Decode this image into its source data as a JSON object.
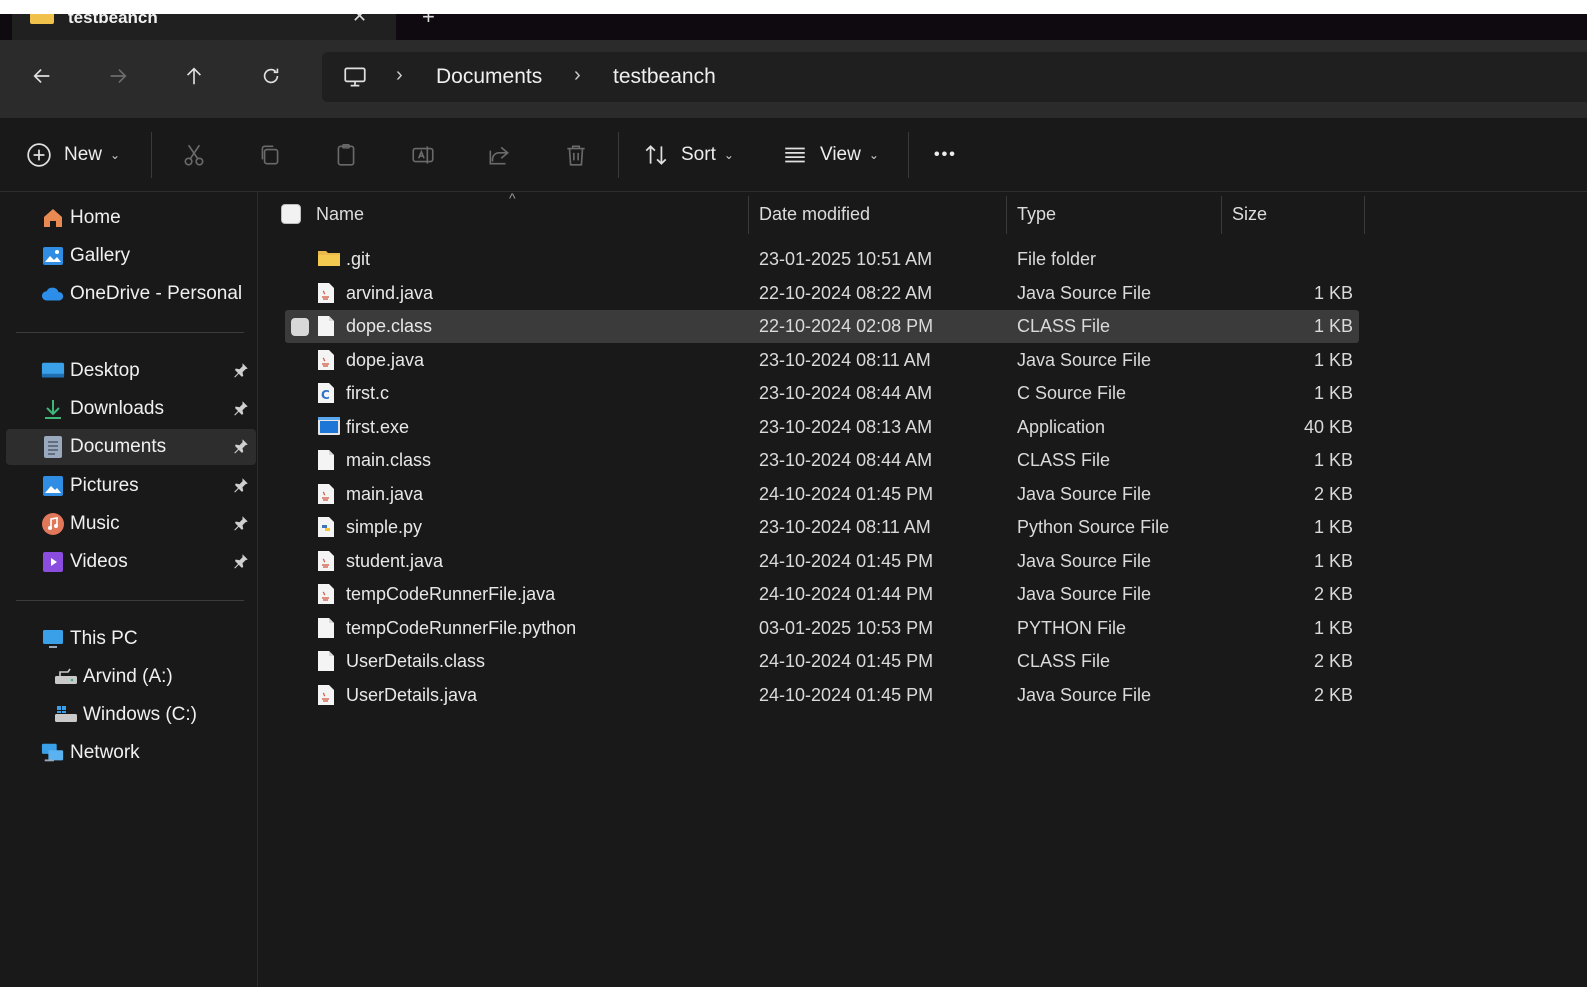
{
  "tab": {
    "title": "testbeanch",
    "close": "✕",
    "new": "+"
  },
  "address": {
    "crumbs": [
      "Documents",
      "testbeanch"
    ],
    "separator": "›"
  },
  "toolbar": {
    "new_label": "New",
    "sort_label": "Sort",
    "view_label": "View",
    "more_label": "•••",
    "chevron": "⌄"
  },
  "sidebar": {
    "quick": [
      {
        "label": "Home",
        "icon": "home-icon"
      },
      {
        "label": "Gallery",
        "icon": "gallery-icon"
      },
      {
        "label": "OneDrive - Personal",
        "icon": "onedrive-icon"
      }
    ],
    "pinned": [
      {
        "label": "Desktop",
        "icon": "desktop-icon"
      },
      {
        "label": "Downloads",
        "icon": "downloads-icon"
      },
      {
        "label": "Documents",
        "icon": "documents-icon",
        "active": true
      },
      {
        "label": "Pictures",
        "icon": "pictures-icon"
      },
      {
        "label": "Music",
        "icon": "music-icon"
      },
      {
        "label": "Videos",
        "icon": "videos-icon"
      }
    ],
    "this_pc": {
      "label": "This PC",
      "icon": "this-pc-icon"
    },
    "drives": [
      {
        "label": "Arvind (A:)",
        "icon": "drive-icon"
      },
      {
        "label": "Windows (C:)",
        "icon": "windows-drive-icon"
      }
    ],
    "network": {
      "label": "Network",
      "icon": "network-icon"
    }
  },
  "filelist": {
    "columns": {
      "name": "Name",
      "date": "Date modified",
      "type": "Type",
      "size": "Size"
    },
    "sort_caret": "^",
    "rows": [
      {
        "name": ".git",
        "date": "23-01-2025 10:51 AM",
        "type": "File folder",
        "size": "",
        "icon": "folder-icon"
      },
      {
        "name": "arvind.java",
        "date": "22-10-2024 08:22 AM",
        "type": "Java Source File",
        "size": "1 KB",
        "icon": "java-file-icon"
      },
      {
        "name": "dope.class",
        "date": "22-10-2024 02:08 PM",
        "type": "CLASS File",
        "size": "1 KB",
        "icon": "blank-file-icon",
        "selected": true
      },
      {
        "name": "dope.java",
        "date": "23-10-2024 08:11 AM",
        "type": "Java Source File",
        "size": "1 KB",
        "icon": "java-file-icon"
      },
      {
        "name": "first.c",
        "date": "23-10-2024 08:44 AM",
        "type": "C Source File",
        "size": "1 KB",
        "icon": "c-file-icon"
      },
      {
        "name": "first.exe",
        "date": "23-10-2024 08:13 AM",
        "type": "Application",
        "size": "40 KB",
        "icon": "exe-file-icon"
      },
      {
        "name": "main.class",
        "date": "23-10-2024 08:44 AM",
        "type": "CLASS File",
        "size": "1 KB",
        "icon": "blank-file-icon"
      },
      {
        "name": "main.java",
        "date": "24-10-2024 01:45 PM",
        "type": "Java Source File",
        "size": "2 KB",
        "icon": "java-file-icon"
      },
      {
        "name": "simple.py",
        "date": "23-10-2024 08:11 AM",
        "type": "Python Source File",
        "size": "1 KB",
        "icon": "python-file-icon"
      },
      {
        "name": "student.java",
        "date": "24-10-2024 01:45 PM",
        "type": "Java Source File",
        "size": "1 KB",
        "icon": "java-file-icon"
      },
      {
        "name": "tempCodeRunnerFile.java",
        "date": "24-10-2024 01:44 PM",
        "type": "Java Source File",
        "size": "2 KB",
        "icon": "java-file-icon"
      },
      {
        "name": "tempCodeRunnerFile.python",
        "date": "03-01-2025 10:53 PM",
        "type": "PYTHON File",
        "size": "1 KB",
        "icon": "blank-file-icon"
      },
      {
        "name": "UserDetails.class",
        "date": "24-10-2024 01:45 PM",
        "type": "CLASS File",
        "size": "2 KB",
        "icon": "blank-file-icon"
      },
      {
        "name": "UserDetails.java",
        "date": "24-10-2024 01:45 PM",
        "type": "Java Source File",
        "size": "2 KB",
        "icon": "java-file-icon"
      }
    ]
  },
  "colors": {
    "background": "#191919",
    "selected_row": "#3b3b3b",
    "folder": "#f1c24b",
    "accent_blue": "#4aa3f0"
  }
}
